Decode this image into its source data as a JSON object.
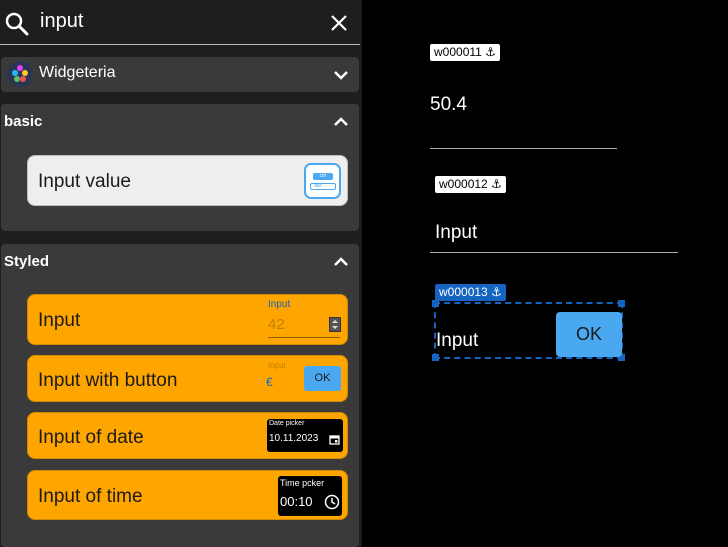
{
  "search": {
    "query": "input"
  },
  "widget_set": {
    "name": "Widgeteria"
  },
  "sections": {
    "basic": {
      "title": "basic",
      "items": [
        {
          "label": "Input value",
          "icon": "input-value-icon",
          "icon_ctrl": "ctrl",
          "icon_abc": "abc"
        }
      ]
    },
    "styled": {
      "title": "Styled",
      "items": [
        {
          "label": "Input",
          "preview_label": "Input",
          "preview_value": "42"
        },
        {
          "label": "Input with button",
          "preview_label": "Input",
          "preview_prefix": "€",
          "preview_button": "OK"
        },
        {
          "label": "Input of date",
          "preview_label": "Date picker",
          "preview_value": "10.11.2023"
        },
        {
          "label": "Input of time",
          "preview_label": "Time pcker",
          "preview_value": "00:10"
        }
      ]
    }
  },
  "canvas": {
    "widgets": [
      {
        "id": "w000011",
        "value": "50.4"
      },
      {
        "id": "w000012",
        "value": "Input"
      },
      {
        "id": "w000013",
        "value": "Input",
        "button": "OK"
      }
    ]
  },
  "colors": {
    "accent_orange": "#ffa500",
    "selection_blue": "#1565c0",
    "ok_button": "#4aa8f0"
  }
}
